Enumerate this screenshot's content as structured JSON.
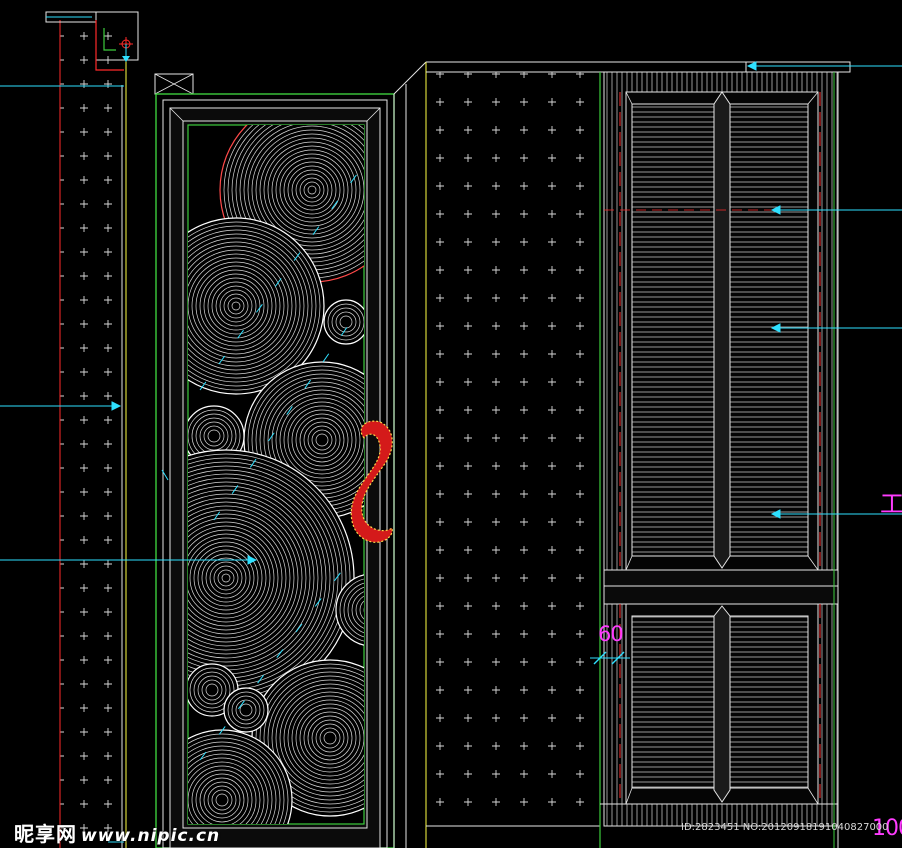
{
  "drawing": {
    "colors": {
      "background": "#000000",
      "frame_green": "#3ccc3c",
      "frame_white": "#e6e6e6",
      "leader_cyan": "#2ee0ff",
      "accent_red": "#ff2a2a",
      "handle_red": "#d41a1a",
      "text_magenta": "#ff3cff",
      "panel_yellow": "#ffff44"
    },
    "icons": [
      "section-marker-icon",
      "door-handle-icon",
      "spiral-pattern-icon",
      "dotted-hatch-icon",
      "leader-arrow-icon"
    ]
  },
  "annotations": {
    "dim_60": "60",
    "dim_100": "100",
    "label_gong": "工"
  },
  "watermark": {
    "brand": "昵享网",
    "url": "www.nipic.cn",
    "id_text": "ID:2823451 NO:20120918191040827000"
  }
}
